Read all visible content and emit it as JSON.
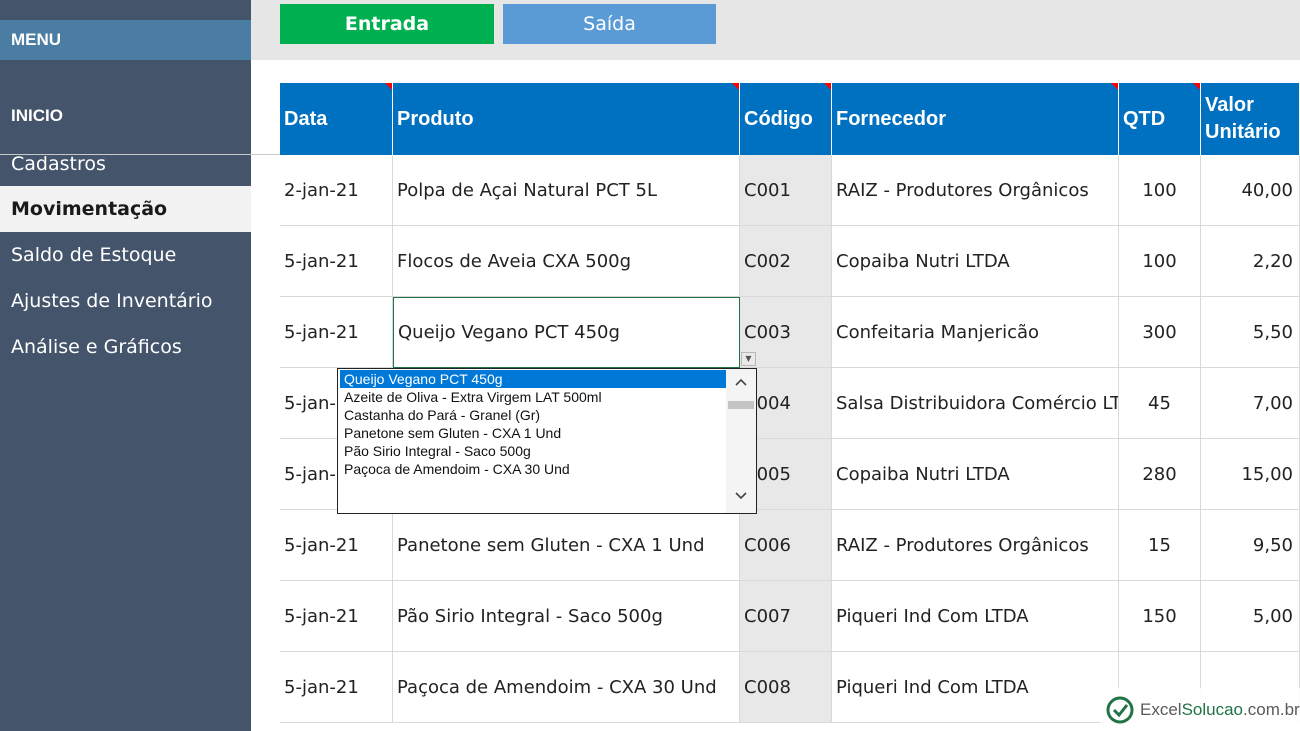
{
  "sidebar": {
    "menu_title": "MENU",
    "section_title": "INICIO",
    "items": [
      "Cadastros",
      "Movimentação",
      "Saldo de Estoque",
      "Ajustes de Inventário",
      "Análise e Gráficos"
    ],
    "active_item": "Movimentação"
  },
  "toolbar": {
    "entrada_label": "Entrada",
    "saida_label": "Saída"
  },
  "table": {
    "columns": [
      "Data",
      "Produto",
      "Código",
      "Fornecedor",
      "QTD",
      "Valor Unitário"
    ],
    "rows": [
      [
        "2-jan-21",
        "Polpa de Açai Natural PCT 5L",
        "C001",
        "RAIZ - Produtores Orgânicos",
        "100",
        "40,00"
      ],
      [
        "5-jan-21",
        "Flocos de Aveia CXA 500g",
        "C002",
        "Copaiba Nutri LTDA",
        "100",
        "2,20"
      ],
      [
        "5-jan-21",
        "Queijo Vegano PCT 450g",
        "C003",
        "Confeitaria Manjericão",
        "300",
        "5,50"
      ],
      [
        "5-jan-21",
        "",
        "C004",
        "Salsa Distribuidora Comércio LTDA",
        "45",
        "7,00"
      ],
      [
        "5-jan-21",
        "",
        "C005",
        "Copaiba Nutri LTDA",
        "280",
        "15,00"
      ],
      [
        "5-jan-21",
        "Panetone sem Gluten - CXA 1 Und",
        "C006",
        "RAIZ - Produtores Orgânicos",
        "15",
        "9,50"
      ],
      [
        "5-jan-21",
        "Pão Sirio Integral - Saco 500g",
        "C007",
        "Piqueri Ind Com LTDA",
        "150",
        "5,00"
      ],
      [
        "5-jan-21",
        "Paçoca de Amendoim - CXA 30 Und",
        "C008",
        "Piqueri Ind Com LTDA",
        "",
        ""
      ]
    ]
  },
  "dropdown": {
    "options": [
      "Queijo Vegano PCT 450g",
      "Azeite de Oliva - Extra Virgem LAT 500ml",
      "Castanha do Pará - Granel (Gr)",
      "Panetone sem Gluten - CXA 1 Und",
      "Pão Sirio Integral - Saco 500g",
      "Paçoca de Amendoim - CXA 30 Und"
    ],
    "selected": "Queijo Vegano PCT 450g"
  },
  "watermark": {
    "brand_part1": "Excel",
    "brand_part2": "Solucao",
    "brand_part3": ".com.br"
  },
  "colors": {
    "header_blue": "#0070c0",
    "sidebar": "#44546a",
    "entrada_green": "#00b050",
    "saida_blue": "#5b9bd5",
    "selection": "#0078d7"
  },
  "icons": {
    "dropdown_arrow": "dropdown-arrow-icon",
    "scroll_up": "chevron-up-icon",
    "scroll_down": "chevron-down-icon",
    "brand": "excelsolucao-logo-icon"
  }
}
